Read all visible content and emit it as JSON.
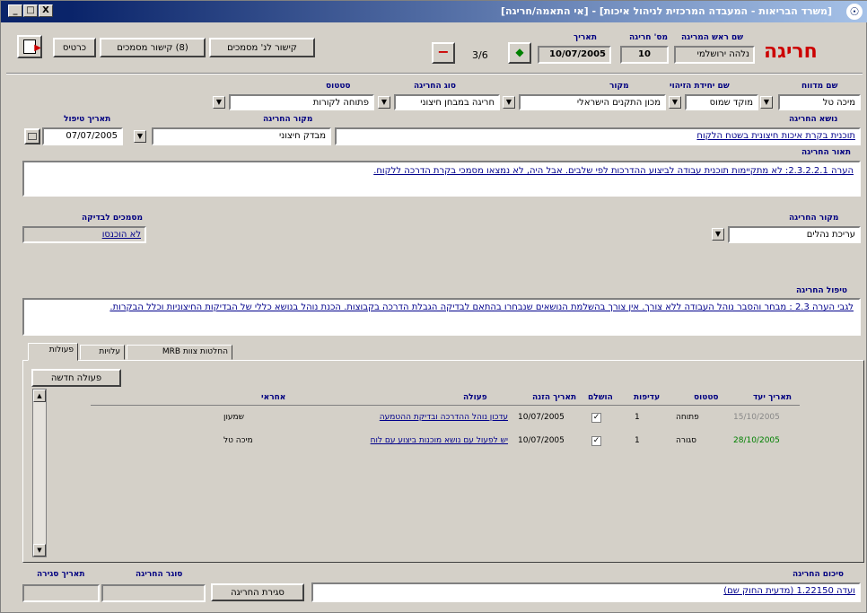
{
  "window": {
    "title": "[משרד הבריאות - המעבדה המרכזית לניהול איכות] - [אי התאמה/חריגה]",
    "min": "_",
    "max": "□",
    "close": "X"
  },
  "toolbar": {
    "exit_icon": "exit-door-icon",
    "btn_close": "כרטיס",
    "btn_lists": "(8) קישור מסמכים",
    "btn_links": "קישור לנ' מסמכים",
    "btn_minus": "−",
    "record_position": "3/6",
    "btn_next": "◆"
  },
  "header": {
    "page_title": "חריגה",
    "manager_label": "שם ראש המריגה",
    "manager_value": "נלהה ירושלמי",
    "number_label": "מס' חריגה",
    "number_value": "10",
    "date_label": "תאריך",
    "date_value": "10/07/2005"
  },
  "row1": {
    "reporter_label": "שם מדווח",
    "reporter_value": "מיכה טל",
    "unit_label": "שם יחידת הזיהוי",
    "unit_value": "מוקד שמוס",
    "source_label": "מקור",
    "source_value": "מכון התקנים הישראלי",
    "type_label": "סוג החריגה",
    "type_value": "חריגה במבחן חיצוני",
    "status_label": "סטטוס",
    "status_value": "פתוחה לקורות"
  },
  "row2": {
    "subject_label": "נושא החריגה",
    "subject_value": "תוכנית בקרת איכות חיצונית בשטח הלקוח",
    "source_label": "מקור החריגה",
    "source_value": "מבדק חיצוני",
    "handle_date_label": "תאריך טיפול",
    "handle_date_value": "07/07/2005"
  },
  "description": {
    "label": "תאור החריגה",
    "text": "הערה 2.3.2.2.1: לא מתקיימות תוכנית עבודה לביצוע ההדרכות לפי שלבים. אבל היה, לא נמצאו מסמכי בקרת הדרכה ללקוח."
  },
  "row3": {
    "origin_label": "מקור החריגה",
    "origin_value": "עריכת נהלים",
    "docs_label": "מסמכים לבדיקה",
    "docs_value": "לא הוכנסו"
  },
  "treatment": {
    "label": "טיפול החריגה",
    "text": "לגבי הערה 2.3 : מבחר והסבר נוהל העבודה ללא צורך. אין צורך בהשלמת הנושאים שנבחרו בהתאם לבדיקה הגבלת הדרכה בקבוצות. הכנת נוהל בנושא כללי של הבדיקות החיצוניות וכלל הבקרות."
  },
  "tabs": {
    "actions": "פעולות",
    "extra": "עלויות",
    "team": "החלטות צוות MRB"
  },
  "actions": {
    "new_button": "פעולה חדשה",
    "columns": {
      "due_date": "תאריך יעד",
      "status": "סטטוס",
      "priority": "עדיפות",
      "done": "הושלם",
      "date_entered": "תאריך הזנה",
      "action": "פעולה",
      "owner": "אחראי"
    },
    "rows": [
      {
        "due_date": "15/10/2005",
        "status": "פתוחה",
        "priority": "1",
        "done": "✓",
        "date_entered": "10/07/2005",
        "action": "עדכון נוהל ההדרכה ובדיקת ההטמעה",
        "owner": "שמעון"
      },
      {
        "due_date": "28/10/2005",
        "status": "סגורה",
        "priority": "1",
        "done": "✓",
        "date_entered": "10/07/2005",
        "action": "יש לפעול עם נושא מוכנות ביצוע עם לוח",
        "owner": "מיכה טל"
      }
    ]
  },
  "footer": {
    "summary_label": "סיכום החריגה",
    "summary_value": "ועדה 1.22150 (מדעית החוק שם)",
    "close_button": "סגירת החריגה",
    "closer_label": "סוגר החריגה",
    "closer_value": "",
    "close_date_label": "תאריך סגירה",
    "close_date_value": ""
  }
}
